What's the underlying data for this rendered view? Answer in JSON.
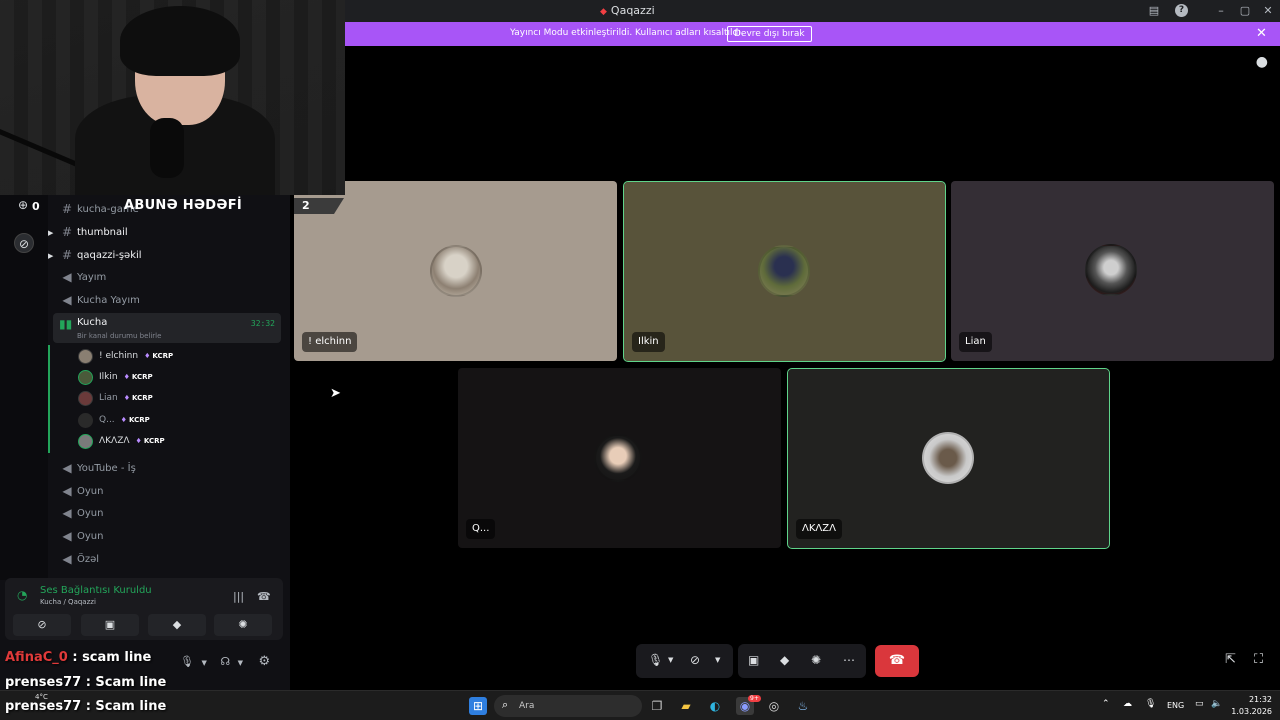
{
  "window": {
    "title": "Qaqazzi"
  },
  "banner": {
    "message": "Yayıncı Modu etkinleştirildi. Kullanıcı adları kısaltıldı.",
    "button": "Devre dışı bırak"
  },
  "overlay": {
    "sub_goal": "ABUNƏ HƏDƏFİ",
    "counter": "0"
  },
  "sidebar": {
    "channels": [
      {
        "name": "kucha-game",
        "type": "text"
      },
      {
        "name": "thumbnail",
        "type": "text"
      },
      {
        "name": "qaqazzi-şəkil",
        "type": "text"
      },
      {
        "name": "Yayım",
        "type": "voice"
      },
      {
        "name": "Kucha Yayım",
        "type": "voice"
      }
    ],
    "active_voice": {
      "name": "Kucha",
      "status": "Bir kanal durumu belirle",
      "timer": "32:32"
    },
    "members": [
      {
        "name": "! elchinn",
        "badge": "KCRP"
      },
      {
        "name": "Ilkin",
        "badge": "KCRP"
      },
      {
        "name": "Lian",
        "badge": "KCRP"
      },
      {
        "name": "Q...",
        "badge": "KCRP"
      },
      {
        "name": "ΛKΛZΛ",
        "badge": "KCRP"
      }
    ],
    "more_channels": [
      {
        "name": "YouTube - İş"
      },
      {
        "name": "Oyun"
      },
      {
        "name": "Oyun"
      },
      {
        "name": "Oyun"
      },
      {
        "name": "Özəl"
      }
    ]
  },
  "voice_panel": {
    "status": "Ses Bağlantısı Kuruldu",
    "location": "Kucha / Qaqazzi"
  },
  "chat": [
    {
      "user": "AfinaC_0",
      "text": ": scam line"
    },
    {
      "user": "prenses77",
      "text": ": Scam line"
    },
    {
      "user": "prenses77",
      "text": ": Scam line"
    }
  ],
  "stage": {
    "participant_count": "2",
    "tiles": [
      {
        "name": "! elchinn",
        "bg": "#a69b8f",
        "speaking": false
      },
      {
        "name": "Ilkin",
        "bg": "#58533a",
        "speaking": true
      },
      {
        "name": "Lian",
        "bg": "#342e35",
        "speaking": false
      },
      {
        "name": "Q...",
        "bg": "#151314",
        "speaking": false
      },
      {
        "name": "ΛKΛZΛ",
        "bg": "#222220",
        "speaking": true
      }
    ]
  },
  "taskbar": {
    "search_placeholder": "Ara",
    "weather": "4°C",
    "lang": "ENG",
    "time": "21:32",
    "date": "1.03.2026",
    "discord_badge": "9+"
  }
}
